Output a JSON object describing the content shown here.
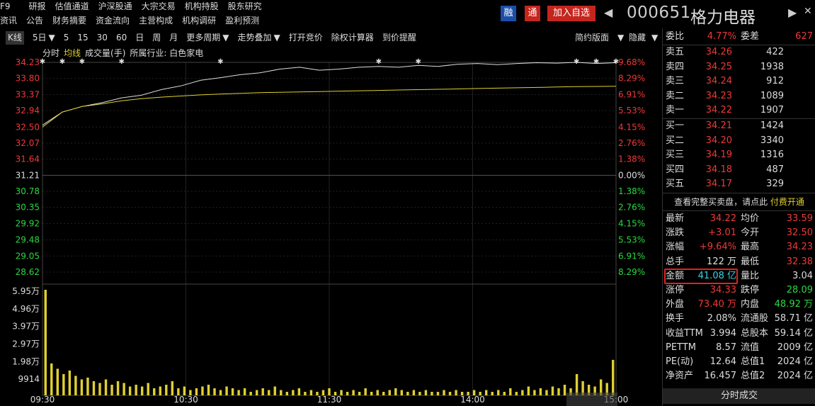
{
  "menu": {
    "row1": [
      "F9",
      "研报",
      "估值通道",
      "沪深股通",
      "大宗交易",
      "机构持股",
      "股东研究"
    ],
    "row2": [
      "资讯",
      "公告",
      "财务摘要",
      "资金流向",
      "主营构成",
      "机构调研",
      "盈利预测"
    ]
  },
  "title": {
    "rong": "融",
    "tong": "通",
    "add_watch": "加入自选",
    "prev": "◀",
    "next": "▶",
    "close": "✕",
    "code": "000651",
    "name": "格力电器"
  },
  "toolbar": {
    "items": [
      "K线",
      "5日",
      "5",
      "15",
      "30",
      "60",
      "日",
      "周",
      "月",
      "更多周期",
      "走势叠加",
      "打开竞价",
      "除权计算器",
      "到价提醒"
    ],
    "right": [
      "简约版面",
      "隐藏"
    ]
  },
  "legend": {
    "items": [
      "分时",
      "均线",
      "成交量(手)",
      "所属行业: 白色家电"
    ]
  },
  "chart_data": {
    "type": "line",
    "title": "",
    "xlabel": "",
    "ylabel": "",
    "x_ticks": [
      "09:30",
      "10:30",
      "11:30",
      "14:00",
      "15:00"
    ],
    "y_price_ticks": [
      34.23,
      33.8,
      33.37,
      32.94,
      32.5,
      32.07,
      31.64,
      31.21,
      30.78,
      30.35,
      29.92,
      29.48,
      29.05,
      28.62
    ],
    "y_pct_ticks": [
      "9.68%",
      "8.29%",
      "6.91%",
      "5.53%",
      "4.15%",
      "2.76%",
      "1.38%",
      "0.00%",
      "1.38%",
      "2.76%",
      "4.15%",
      "5.53%",
      "6.91%",
      "8.29%"
    ],
    "y_vol_ticks": [
      "5.95万",
      "4.96万",
      "3.97万",
      "2.97万",
      "1.98万",
      "9914"
    ],
    "ylim": [
      28.62,
      34.23
    ],
    "prev_close": 31.21,
    "series": [
      {
        "name": "分时",
        "color": "#dddddd",
        "values": [
          32.55,
          32.9,
          33.05,
          33.15,
          33.28,
          33.35,
          33.5,
          33.6,
          33.75,
          33.82,
          33.9,
          33.95,
          34.05,
          34.1,
          34.02,
          34.05,
          34.1,
          34.12,
          34.1,
          34.15,
          34.12,
          34.18,
          34.2,
          34.17,
          34.2,
          34.22,
          34.21,
          34.23,
          34.2,
          34.22
        ]
      },
      {
        "name": "均线",
        "color": "#e0d030",
        "values": [
          32.5,
          32.9,
          33.05,
          33.12,
          33.2,
          33.26,
          33.3,
          33.33,
          33.36,
          33.38,
          33.4,
          33.42,
          33.43,
          33.44,
          33.45,
          33.46,
          33.47,
          33.48,
          33.49,
          33.5,
          33.51,
          33.52,
          33.53,
          33.54,
          33.55,
          33.56,
          33.57,
          33.58,
          33.585,
          33.59
        ]
      }
    ],
    "volume_max": 59500,
    "volume": [
      59500,
      18000,
      15000,
      12000,
      14000,
      11000,
      9000,
      10000,
      8000,
      7000,
      9000,
      6000,
      8000,
      7000,
      5000,
      6000,
      5000,
      7000,
      4000,
      5000,
      6000,
      8000,
      4000,
      5000,
      3000,
      4000,
      5000,
      6000,
      4000,
      3000,
      5000,
      4000,
      3000,
      4000,
      2000,
      3000,
      4000,
      3000,
      5000,
      3000,
      2000,
      3000,
      4000,
      2000,
      3000,
      2000,
      3000,
      4000,
      2000,
      3000,
      2000,
      3000,
      2000,
      4000,
      2000,
      3000,
      2000,
      3000,
      4000,
      3000,
      2000,
      3000,
      2000,
      3000,
      2000,
      2000,
      3000,
      2000,
      3000,
      2000,
      2000,
      3000,
      2000,
      3000,
      2000,
      3000,
      2000,
      4000,
      2000,
      3000,
      5000,
      3000,
      4000,
      3000,
      5000,
      4000,
      6000,
      4000,
      12000,
      8000,
      6000,
      5000,
      9000,
      7000,
      20000
    ]
  },
  "sidebar": {
    "weibi": {
      "label": "委比",
      "value": "4.77%",
      "label2": "委差",
      "value2": "627"
    },
    "asks": [
      {
        "label": "卖五",
        "price": "34.26",
        "qty": "422"
      },
      {
        "label": "卖四",
        "price": "34.25",
        "qty": "1938"
      },
      {
        "label": "卖三",
        "price": "34.24",
        "qty": "912"
      },
      {
        "label": "卖二",
        "price": "34.23",
        "qty": "1089"
      },
      {
        "label": "卖一",
        "price": "34.22",
        "qty": "1907"
      }
    ],
    "bids": [
      {
        "label": "买一",
        "price": "34.21",
        "qty": "1424"
      },
      {
        "label": "买二",
        "price": "34.20",
        "qty": "3340"
      },
      {
        "label": "买三",
        "price": "34.19",
        "qty": "1316"
      },
      {
        "label": "买四",
        "price": "34.18",
        "qty": "487"
      },
      {
        "label": "买五",
        "price": "34.17",
        "qty": "329"
      }
    ],
    "note": "查看完整买卖盘，请点此",
    "note_link": "付费开通",
    "stats": [
      [
        "最新",
        "34.22",
        "均价",
        "33.59"
      ],
      [
        "涨跌",
        "+3.01",
        "今开",
        "32.50"
      ],
      [
        "涨幅",
        "+9.64%",
        "最高",
        "34.23"
      ],
      [
        "总手",
        "122 万",
        "最低",
        "32.38"
      ],
      [
        "金额",
        "41.08 亿",
        "量比",
        "3.04"
      ],
      [
        "涨停",
        "34.33",
        "跌停",
        "28.09"
      ],
      [
        "外盘",
        "73.40 万",
        "内盘",
        "48.92 万"
      ],
      [
        "换手",
        "2.08%",
        "流通股",
        "58.71 亿"
      ],
      [
        "收益TTM",
        "3.994",
        "总股本",
        "59.14 亿"
      ],
      [
        "PETTM",
        "8.57",
        "流值",
        "2009 亿"
      ],
      [
        "PE(动)",
        "12.64",
        "总值1",
        "2024 亿"
      ],
      [
        "净资产",
        "16.457",
        "总值2",
        "2024 亿"
      ]
    ],
    "ticks_title": "分时成交"
  }
}
